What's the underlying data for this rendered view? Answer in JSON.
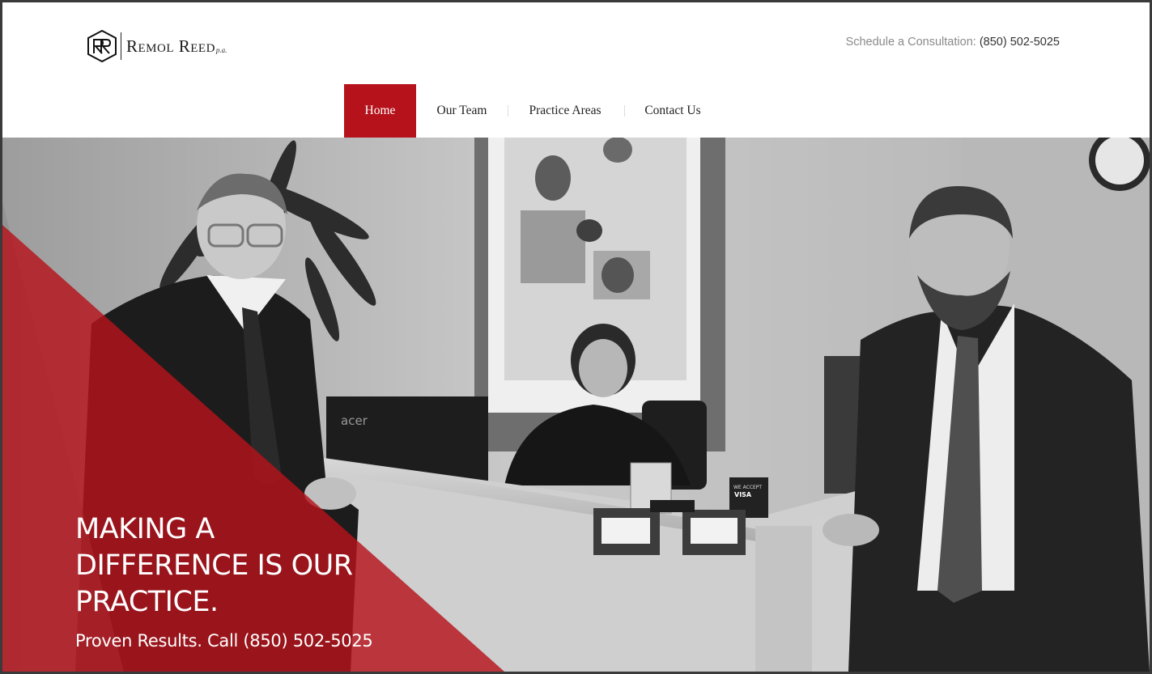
{
  "brand": {
    "name": "Remol Reed",
    "suffix": "p.a.",
    "accent_color": "#b5121b"
  },
  "header": {
    "consult_label": "Schedule a Consultation:",
    "consult_phone": "(850) 502-5025"
  },
  "nav": {
    "items": [
      {
        "label": "Home",
        "active": true
      },
      {
        "label": "Our Team",
        "active": false
      },
      {
        "label": "Practice Areas",
        "active": false
      },
      {
        "label": "Contact Us",
        "active": false
      }
    ]
  },
  "hero": {
    "headline_line1": "MAKING A",
    "headline_line2": "DIFFERENCE IS OUR",
    "headline_line3": "PRACTICE.",
    "subline": "Proven Results. Call (850) 502-5025",
    "monitor_brand": "acer",
    "card_sign": "WE ACCEPT",
    "card_sign_brand": "VISA"
  }
}
